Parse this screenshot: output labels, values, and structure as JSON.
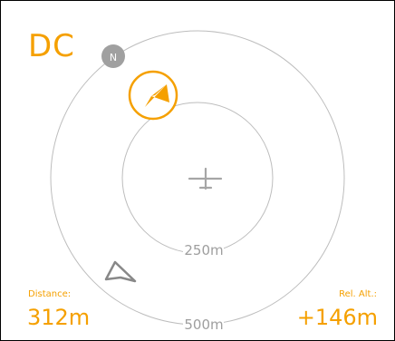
{
  "target": {
    "callsign": "DC"
  },
  "compass": {
    "north_label": "N"
  },
  "radar": {
    "inner_ring_label": "250m",
    "outer_ring_label": "500m"
  },
  "readouts": {
    "distance_label": "Distance:",
    "distance_value": "312m",
    "relative_altitude_label": "Rel. Alt.:",
    "relative_altitude_value": "+146m"
  },
  "colors": {
    "accent": "#f5a000",
    "ring": "#bdbdbd",
    "range_text": "#9e9e9e",
    "own_aircraft": "#a6a6a6",
    "north_badge": "#a0a0a0",
    "other_traffic": "#888888"
  },
  "icons": {
    "own_aircraft": "airplane-icon",
    "target": "navigation-arrow-icon",
    "other_traffic": "navigation-arrow-outline-icon",
    "north": "north-indicator-icon"
  }
}
